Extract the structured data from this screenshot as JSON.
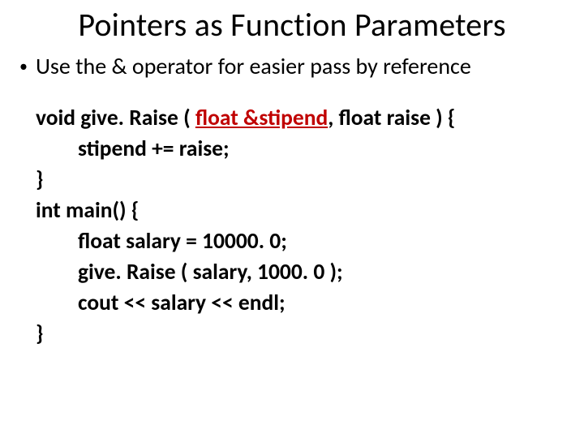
{
  "title": "Pointers as Function Parameters",
  "bullet": "Use the & operator for easier pass by reference",
  "code": {
    "fn_sig_pre": "void give. Raise ( ",
    "fn_sig_ref": "float &stipend",
    "fn_sig_post": ", float raise ) {",
    "l2": "stipend += raise;",
    "l3": "}",
    "l4": "int main() {",
    "l5": "float salary = 10000. 0;",
    "l6": "give. Raise ( salary, 1000. 0 );",
    "l7": "cout << salary << endl;",
    "l8": "}"
  }
}
